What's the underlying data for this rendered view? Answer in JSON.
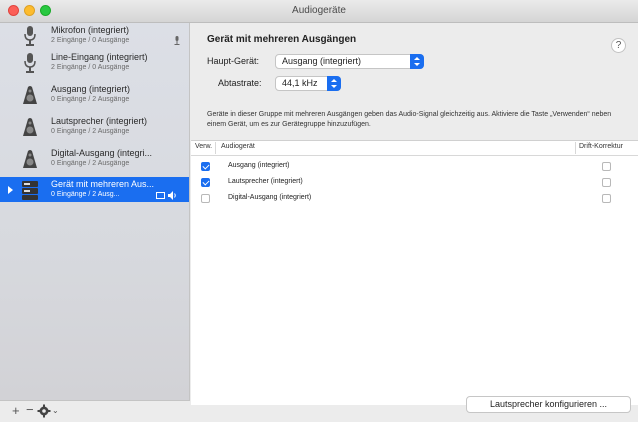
{
  "window": {
    "title": "Audiogeräte"
  },
  "sidebar": {
    "devices": [
      {
        "name": "Mikrofon (integriert)",
        "sub": "2 Eingänge / 0 Ausgänge",
        "icon": "microphone-icon"
      },
      {
        "name": "Line-Eingang (integriert)",
        "sub": "2 Eingänge / 0 Ausgänge",
        "icon": "line-in-icon"
      },
      {
        "name": "Ausgang (integriert)",
        "sub": "0 Eingänge / 2 Ausgänge",
        "icon": "speaker-icon"
      },
      {
        "name": "Lautsprecher (integriert)",
        "sub": "0 Eingänge / 2 Ausgänge",
        "icon": "speaker-icon"
      },
      {
        "name": "Digital-Ausgang (integri...",
        "sub": "0 Eingänge / 2 Ausgänge",
        "icon": "speaker-icon"
      },
      {
        "name": "Gerät mit mehreren Aus...",
        "sub": "0 Eingänge / 2 Ausg...",
        "icon": "multi-output-icon",
        "selected": true
      }
    ],
    "footer": {
      "add": "+",
      "remove": "−",
      "chevron": "⌄"
    }
  },
  "main": {
    "heading": "Gerät mit mehreren Ausgängen",
    "help": "?",
    "master_label": "Haupt-Gerät:",
    "master_value": "Ausgang (integriert)",
    "rate_label": "Abtastrate:",
    "rate_value": "44,1 kHz",
    "description": "Geräte in dieser Gruppe mit mehreren Ausgängen geben das Audio-Signal gleichzeitig aus. Aktiviere die Taste „Verwenden“ neben einem Gerät, um es zur Gerätegruppe hinzuzufügen.",
    "table": {
      "col_use": "Verw.",
      "col_device": "Audiogerät",
      "col_drift": "Drift-Korrektur",
      "rows": [
        {
          "name": "Ausgang (integriert)",
          "use": true,
          "drift": false
        },
        {
          "name": "Lautsprecher (integriert)",
          "use": true,
          "drift": false
        },
        {
          "name": "Digital-Ausgang (integriert)",
          "use": false,
          "drift": false
        }
      ]
    },
    "configure_button": "Lautsprecher konfigurieren ..."
  },
  "colors": {
    "accent": "#1a6ef0",
    "sidebar": "#d7d9de",
    "window": "#ececec"
  }
}
